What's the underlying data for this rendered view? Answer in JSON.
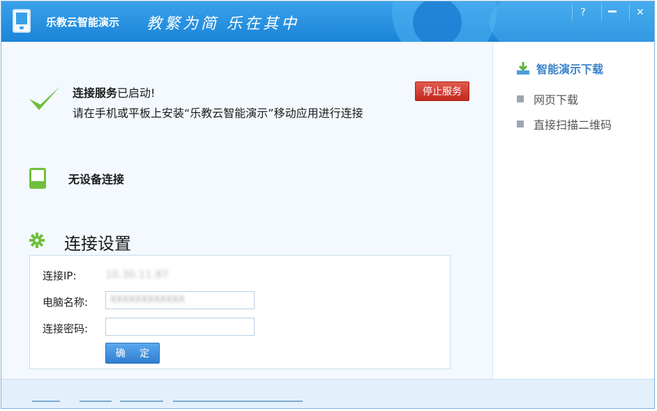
{
  "window": {
    "app_title": "乐教云智能演示",
    "slogan": "教繁为简 乐在其中",
    "controls": {
      "help": "?",
      "close": "✕"
    }
  },
  "status": {
    "service_label": "连接服务",
    "service_state": "已启动!",
    "instruction": "请在手机或平板上安装“乐教云智能演示”移动应用进行连接",
    "stop_button": "停止服务",
    "device_text": "无设备连接"
  },
  "settings": {
    "title": "连接设置",
    "ip_label": "连接IP:",
    "ip_value": "10.30.11.87",
    "name_label": "电脑名称:",
    "name_value": "XXXXXXXXXXXX",
    "password_label": "连接密码:",
    "password_value": "",
    "confirm_button": "确 定"
  },
  "sidebar": {
    "heading": "智能演示下载",
    "items": [
      {
        "label": "网页下载"
      },
      {
        "label": "直接扫描二维码"
      }
    ]
  },
  "colors": {
    "titlebar": "#1a84d8",
    "check": "#6fbf3c",
    "stop_button": "#c2281e",
    "link": "#3a83c9"
  }
}
